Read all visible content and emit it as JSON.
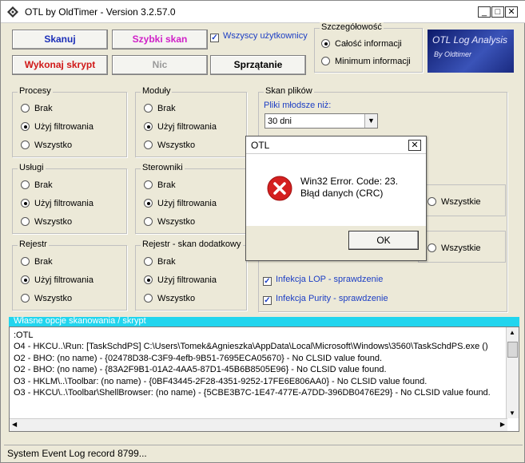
{
  "window": {
    "title": "OTL by OldTimer - Version 3.2.57.0"
  },
  "toolbar": {
    "scan": "Skanuj",
    "quick_scan": "Szybki skan",
    "run_script": "Wykonaj skrypt",
    "nothing": "Nic",
    "cleanup": "Sprzątanie",
    "all_users_label": "Wszyscy użytkownicy"
  },
  "detail_group": {
    "title": "Szczegółowość",
    "options": [
      "Całość informacji",
      "Minimum informacji"
    ],
    "selected": 0
  },
  "logo": {
    "line1": "OTL Log Analysis",
    "line2": "By Oldtimer"
  },
  "groups": {
    "procesy": {
      "title": "Procesy",
      "options": [
        "Brak",
        "Użyj filtrowania",
        "Wszystko"
      ],
      "selected": 1
    },
    "moduly": {
      "title": "Moduły",
      "options": [
        "Brak",
        "Użyj filtrowania",
        "Wszystko"
      ],
      "selected": 1
    },
    "uslugi": {
      "title": "Usługi",
      "options": [
        "Brak",
        "Użyj filtrowania",
        "Wszystko"
      ],
      "selected": 1
    },
    "sterowniki": {
      "title": "Sterowniki",
      "options": [
        "Brak",
        "Użyj filtrowania",
        "Wszystko"
      ],
      "selected": 1
    },
    "rejestr": {
      "title": "Rejestr",
      "options": [
        "Brak",
        "Użyj filtrowania",
        "Wszystko"
      ],
      "selected": 1
    },
    "rejestr_dodatkowy": {
      "title": "Rejestr - skan dodatkowy",
      "options": [
        "Brak",
        "Użyj filtrowania",
        "Wszystko"
      ],
      "selected": 1
    }
  },
  "file_scan": {
    "title": "Skan plików",
    "newer_label": "Pliki młodsze niż:",
    "newer_value": "30 dni",
    "all_label_1": "Wszystkie",
    "all_label_2": "Wszystkie",
    "lop_check": "Infekcja LOP - sprawdzenie",
    "purity_check": "Infekcja Purity - sprawdzenie"
  },
  "script": {
    "header": "Własne opcje skanowania / skrypt",
    "lines": [
      ":OTL",
      "O4 - HKCU..\\Run: [TaskSchdPS] C:\\Users\\Tomek&Agnieszka\\AppData\\Local\\Microsoft\\Windows\\3560\\TaskSchdPS.exe ()",
      "O2 - BHO: (no name) - {02478D38-C3F9-4efb-9B51-7695ECA05670} - No CLSID value found.",
      "O2 - BHO: (no name) - {83A2F9B1-01A2-4AA5-87D1-45B6B8505E96} - No CLSID value found.",
      "O3 - HKLM\\..\\Toolbar: (no name) - {0BF43445-2F28-4351-9252-17FE6E806AA0} - No CLSID value found.",
      "O3 - HKCU\\..\\Toolbar\\ShellBrowser: (no name) - {5CBE3B7C-1E47-477E-A7DD-396DB0476E29} - No CLSID value found."
    ]
  },
  "status": {
    "text": "System Event Log record 8799..."
  },
  "dialog": {
    "title": "OTL",
    "message_line1": "Win32 Error.  Code: 23.",
    "message_line2": "Błąd danych (CRC)",
    "ok": "OK"
  },
  "colors": {
    "scan": "#1c2fb8",
    "quick_scan": "#d020c8",
    "run_script": "#d01818",
    "accent": "#22d5ee"
  }
}
